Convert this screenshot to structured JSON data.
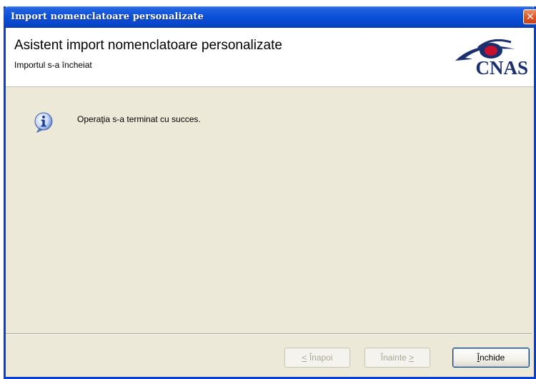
{
  "window": {
    "title": "Import nomenclatoare personalizate",
    "close_glyph": "✕"
  },
  "header": {
    "title": "Asistent import nomenclatoare personalizate",
    "subtitle": "Importul s-a încheiat",
    "logo_text": "CNAS",
    "logo_color": "#1a2f6e",
    "logo_accent_color": "#c8102e"
  },
  "content": {
    "icon": "info-icon",
    "message": "Operaţia s-a terminat cu succes."
  },
  "buttons": {
    "back": {
      "underline": "<",
      "rest": " Înapoi",
      "enabled": false
    },
    "next": {
      "rest": "Înainte ",
      "underline": ">",
      "enabled": false
    },
    "close": {
      "underline": "Î",
      "rest": "nchide",
      "enabled": true
    }
  },
  "colors": {
    "titlebar": "#0a4fd8",
    "dialog_bg": "#ece9d8",
    "close_button": "#e05a2c"
  }
}
